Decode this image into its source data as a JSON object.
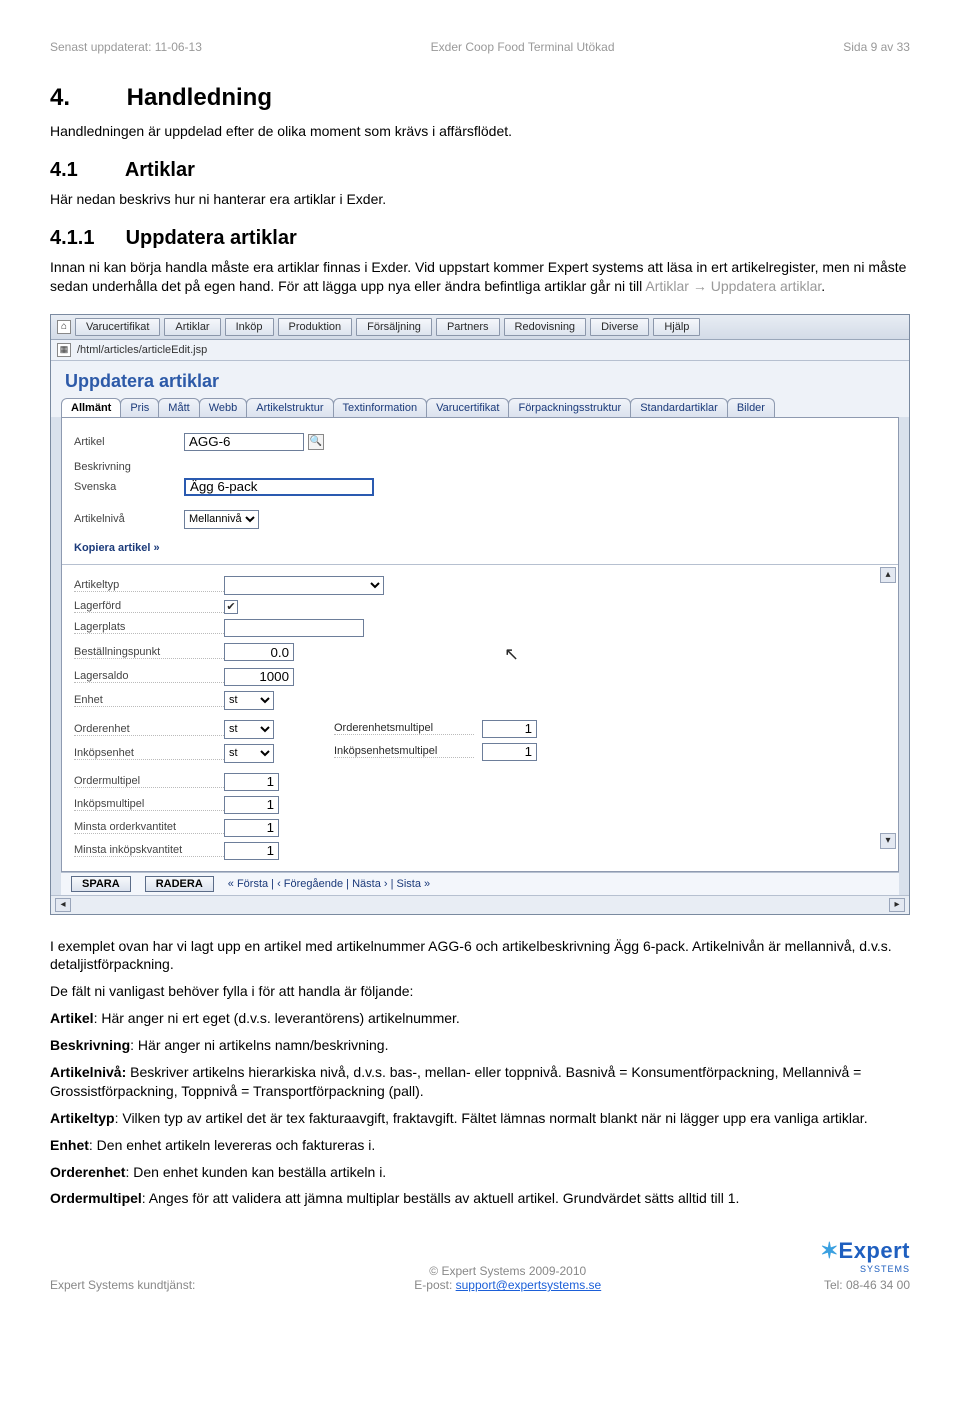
{
  "header": {
    "left": "Senast uppdaterat: 11-06-13",
    "center": "Exder Coop Food Terminal Utökad",
    "right": "Sida 9 av 33"
  },
  "section": {
    "num": "4.",
    "title": "Handledning"
  },
  "intro": "Handledningen är uppdelad efter de olika moment som krävs i affärsflödet.",
  "sub41": {
    "num": "4.1",
    "title": "Artiklar"
  },
  "p41": "Här nedan beskrivs hur ni hanterar era artiklar i Exder.",
  "sub411": {
    "num": "4.1.1",
    "title": "Uppdatera artiklar"
  },
  "p411a": "Innan ni kan börja handla måste era artiklar finnas i Exder. Vid uppstart kommer Expert systems att läsa in ert artikelregister, men ni måste sedan underhålla det på egen hand. För att lägga upp nya eller ändra befintliga artiklar går ni till ",
  "p411nav1": "Artiklar",
  "p411arrow": "→",
  "p411nav2": "Uppdatera artiklar",
  "p411dot": ".",
  "app": {
    "menus": [
      "Varucertifikat",
      "Artiklar",
      "Inköp",
      "Produktion",
      "Försäljning",
      "Partners",
      "Redovisning",
      "Diverse",
      "Hjälp"
    ],
    "path": "/html/articles/articleEdit.jsp",
    "title": "Uppdatera artiklar",
    "tabs": [
      "Allmänt",
      "Pris",
      "Mått",
      "Webb",
      "Artikelstruktur",
      "Textinformation",
      "Varucertifikat",
      "Förpackningsstruktur",
      "Standardartiklar",
      "Bilder"
    ],
    "labels": {
      "artikel": "Artikel",
      "beskrivning": "Beskrivning",
      "svenska": "Svenska",
      "artikelniva": "Artikelnivå",
      "kopiera": "Kopiera artikel »",
      "artikeltyp": "Artikeltyp",
      "lagerford": "Lagerförd",
      "lagerplats": "Lagerplats",
      "bestpunkt": "Beställningspunkt",
      "lagersaldo": "Lagersaldo",
      "enhet": "Enhet",
      "orderenhet": "Orderenhet",
      "inkopsenhet": "Inköpsenhet",
      "ordermultipel": "Ordermultipel",
      "inkopsmultipel": "Inköpsmultipel",
      "minorder": "Minsta orderkvantitet",
      "mininkop": "Minsta inköpskvantitet",
      "orderenhetsmultipel": "Orderenhetsmultipel",
      "inkopsenhetsmultipel": "Inköpsenhetsmultipel"
    },
    "values": {
      "artikel": "AGG-6",
      "svenska": "Ägg 6-pack",
      "artikelniva": "Mellannivå",
      "bestpunkt": "0.0",
      "lagersaldo": "1000",
      "enhet": "st",
      "orderenhet": "st",
      "inkopsenhet": "st",
      "ordermultipel": "1",
      "inkopsmultipel": "1",
      "minorder": "1",
      "mininkop": "1",
      "orderenhetsmultipel": "1",
      "inkopsenhetsmultipel": "1"
    },
    "buttons": {
      "spara": "SPARA",
      "radera": "RADERA"
    },
    "nav": "« Första  |  ‹ Föregående  |  Nästa ›  |  Sista »"
  },
  "after1": "I exemplet ovan har vi lagt upp en artikel med artikelnummer AGG-6 och artikelbeskrivning Ägg 6-pack. Artikelnivån är mellannivå, d.v.s. detaljistförpackning.",
  "after2": "De fält ni vanligast behöver fylla i för att handla är följande:",
  "def_artikel_l": "Artikel",
  "def_artikel_t": ": Här anger ni ert eget (d.v.s. leverantörens) artikelnummer.",
  "def_beskr_l": "Beskrivning",
  "def_beskr_t": ": Här anger ni artikelns namn/beskrivning.",
  "def_niva_l": "Artikelnivå:",
  "def_niva_t": " Beskriver artikelns hierarkiska nivå, d.v.s. bas-, mellan- eller toppnivå. Basnivå = Konsumentförpackning, Mellannivå = Grossistförpackning, Toppnivå = Transportförpackning (pall).",
  "def_typ_l": "Artikeltyp",
  "def_typ_t": ": Vilken typ av artikel det är tex fakturaavgift, fraktavgift. Fältet lämnas normalt blankt när ni lägger upp era vanliga artiklar.",
  "def_enhet_l": "Enhet",
  "def_enhet_t": ": Den enhet artikeln levereras och faktureras i.",
  "def_oenhet_l": "Orderenhet",
  "def_oenhet_t": ": Den enhet kunden kan beställa artikeln i.",
  "def_omult_l": "Ordermultipel",
  "def_omult_t": ": Anges för att validera att jämna multiplar beställs av aktuell artikel. Grundvärdet sätts alltid till 1.",
  "footer": {
    "left": "Expert Systems kundtjänst:",
    "copy": "© Expert Systems 2009-2010",
    "eprefix": "E-post: ",
    "email": "support@expertsystems.se",
    "tel": "Tel: 08-46 34 00",
    "logo": "Expert",
    "logosub": "SYSTEMS"
  }
}
